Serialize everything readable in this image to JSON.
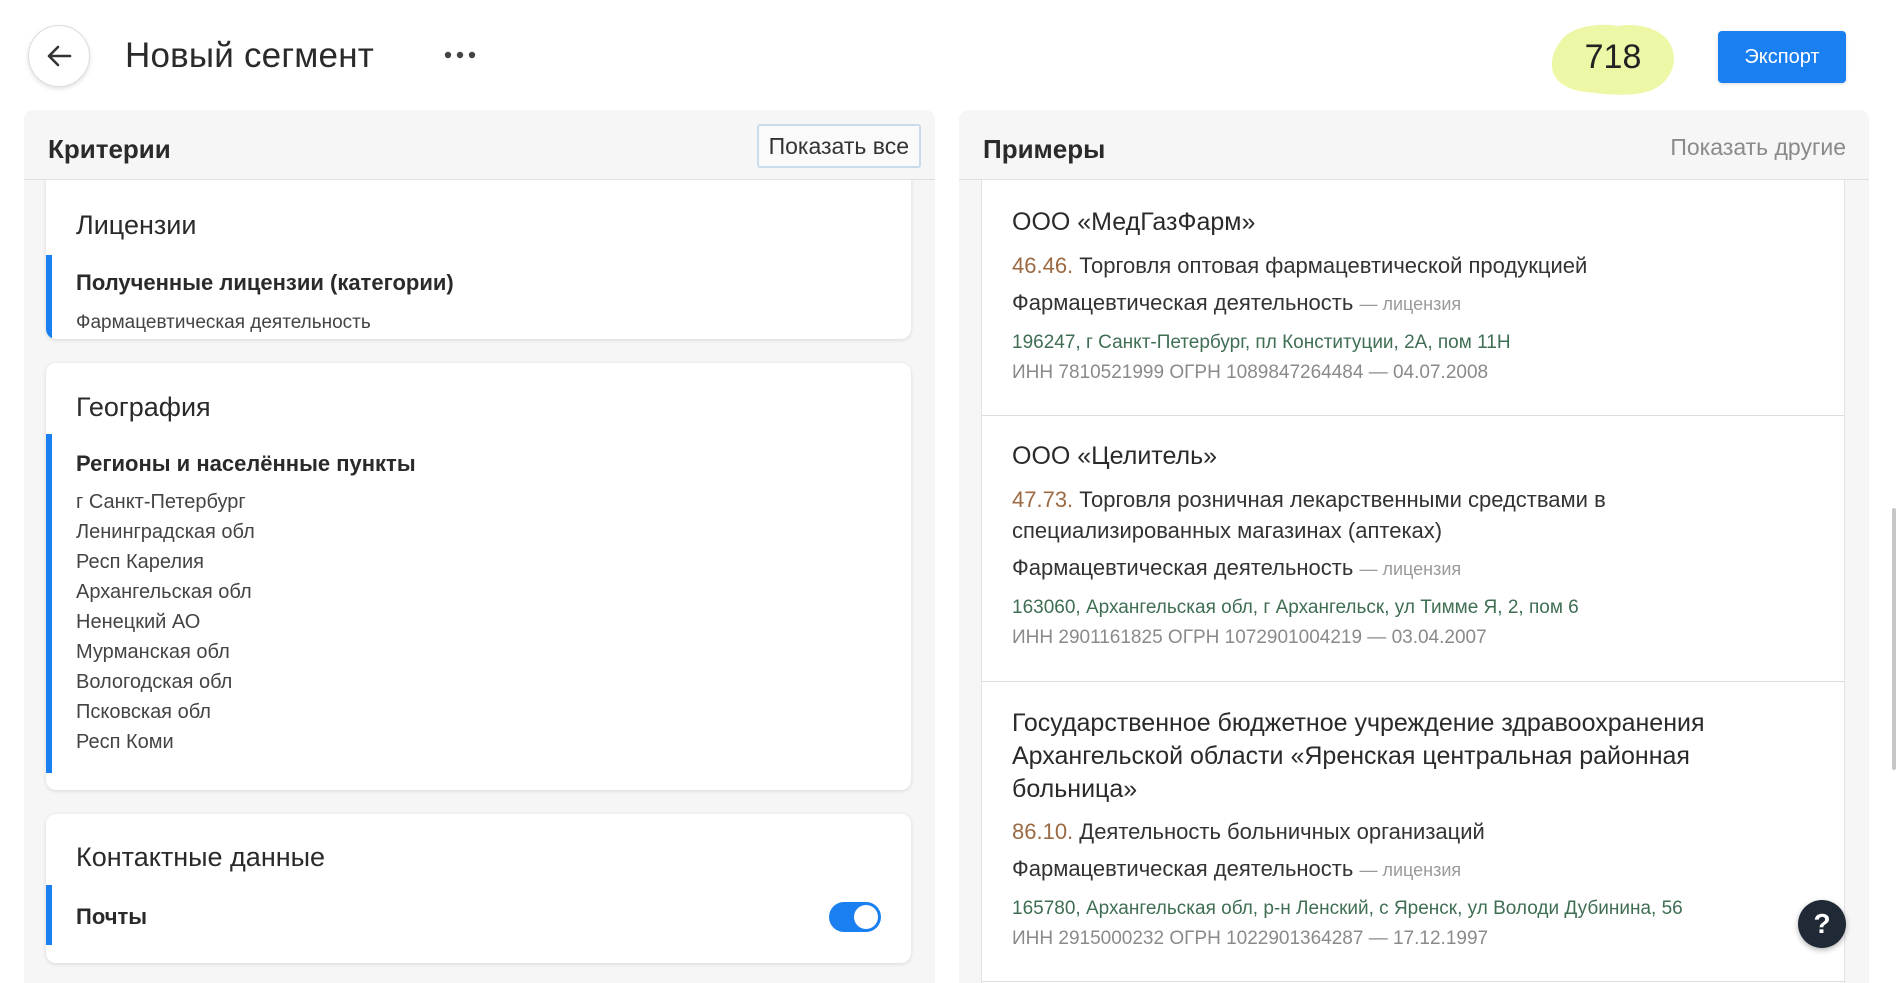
{
  "header": {
    "title": "Новый сегмент",
    "count": "718",
    "export_label": "Экспорт",
    "back_icon": "arrow-left-icon",
    "more_icon": "more-horizontal-icon",
    "count_highlight_color": "#eef7a6",
    "accent_color": "#1a7ff0"
  },
  "criteria": {
    "title": "Критерии",
    "show_all_label": "Показать все",
    "licenses": {
      "title": "Лицензии",
      "label": "Полученные лицензии (категории)",
      "value": "Фармацевтическая деятельность"
    },
    "geography": {
      "title": "География",
      "label": "Регионы и населённые пункты",
      "regions": [
        "г Санкт-Петербург",
        "Ленинградская обл",
        "Респ Карелия",
        "Архангельская обл",
        "Ненецкий АО",
        "Мурманская обл",
        "Вологодская обл",
        "Псковская обл",
        "Респ Коми"
      ]
    },
    "contacts": {
      "title": "Контактные данные",
      "label": "Почты",
      "enabled": true
    }
  },
  "examples": {
    "title": "Примеры",
    "show_other_label": "Показать другие",
    "items": [
      {
        "name": "ООО «МедГазФарм»",
        "okved_code": "46.46.",
        "okved_text": "Торговля оптовая фармацевтической продукцией",
        "license": "Фармацевтическая деятельность",
        "license_suffix": "— лицензия",
        "address": "196247, г Санкт-Петербург, пл Конституции, 2А, пом 11Н",
        "ids": "ИНН 7810521999 ОГРН 1089847264484 — 04.07.2008"
      },
      {
        "name": "ООО «Целитель»",
        "okved_code": "47.73.",
        "okved_text": "Торговля розничная лекарственными средствами в специализированных магазинах (аптеках)",
        "license": "Фармацевтическая деятельность",
        "license_suffix": "— лицензия",
        "address": "163060, Архангельская обл, г Архангельск, ул Тимме Я, 2, пом 6",
        "ids": "ИНН 2901161825 ОГРН 1072901004219 — 03.04.2007"
      },
      {
        "name": "Государственное бюджетное учреждение здравоохранения Архангельской области «Яренская центральная районная больница»",
        "okved_code": "86.10.",
        "okved_text": "Деятельность больничных организаций",
        "license": "Фармацевтическая деятельность",
        "license_suffix": "— лицензия",
        "address": "165780, Архангельская обл, р-н Ленский, с Яренск, ул Володи Дубинина, 56",
        "ids": "ИНН 2915000232 ОГРН 1022901364287 — 17.12.1997"
      }
    ]
  },
  "help": {
    "label": "?",
    "icon": "help-icon"
  }
}
